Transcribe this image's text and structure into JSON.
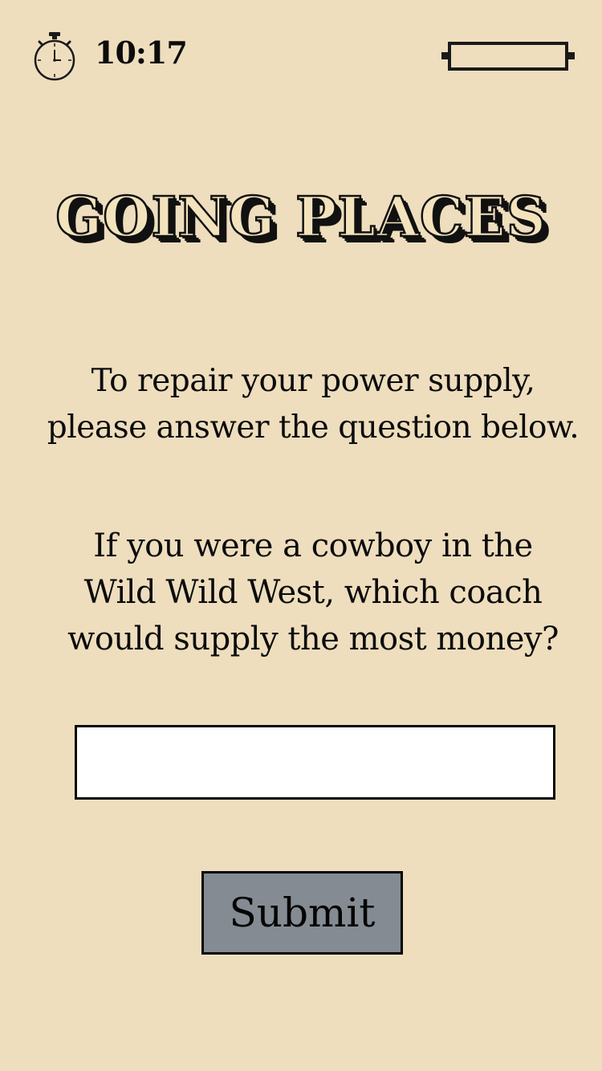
{
  "status_bar": {
    "time": "10:17",
    "clock_icon": "stopwatch-icon",
    "battery_icon": "battery-empty-icon"
  },
  "title": "GOING PLACES",
  "instruction": {
    "line1": "To repair your power supply,",
    "line2": "please answer the question below."
  },
  "question": {
    "line1": "If you were a cowboy in the",
    "line2": "Wild Wild West, which coach",
    "line3": "would supply the most money?"
  },
  "answer": {
    "value": "",
    "placeholder": ""
  },
  "submit_label": "Submit",
  "colors": {
    "background": "#eedebe",
    "text": "#0c0c0c",
    "input_background": "#ffffff",
    "button_background": "#858b93"
  }
}
